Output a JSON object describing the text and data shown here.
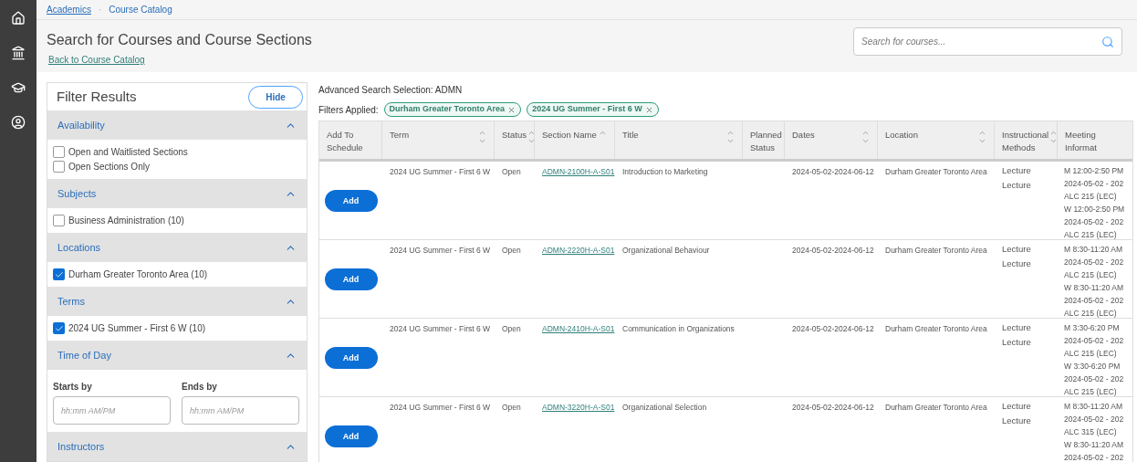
{
  "nav": {
    "items": [
      {
        "selected": false
      },
      {
        "selected": false
      },
      {
        "selected": false
      },
      {
        "selected": false
      }
    ]
  },
  "breadcrumb": [
    "Academics",
    "·",
    "Course Catalog"
  ],
  "header": {
    "title": "Search for Courses and Course Sections",
    "back_link": "Back to Course Catalog",
    "search": {
      "placeholder": "Search for courses..."
    }
  },
  "filter": {
    "title": "Filter Results",
    "hide_button": "Hide",
    "sections": [
      {
        "kind": "checkboxes",
        "title": "Availability",
        "expanded": true,
        "options": [
          {
            "label": "Open and Waitlisted Sections",
            "checked": false
          },
          {
            "label": "Open Sections Only",
            "checked": false
          }
        ]
      },
      {
        "kind": "checkboxes",
        "title": "Subjects",
        "expanded": true,
        "options": [
          {
            "label": "Business Administration (10)",
            "checked": false
          }
        ]
      },
      {
        "kind": "checkboxes",
        "title": "Locations",
        "expanded": true,
        "options": [
          {
            "label": "Durham Greater Toronto Area (10)",
            "checked": true
          }
        ]
      },
      {
        "kind": "checkboxes",
        "title": "Terms",
        "expanded": true,
        "options": [
          {
            "label": "2024 UG Summer - First 6 W (10)",
            "checked": true
          }
        ]
      },
      {
        "kind": "time",
        "title": "Time of Day",
        "expanded": true,
        "fields": [
          {
            "label": "Starts by",
            "placeholder": "hh:mm AM/PM"
          },
          {
            "label": "Ends by",
            "placeholder": "hh:mm AM/PM"
          }
        ]
      },
      {
        "kind": "checkboxes",
        "title": "Instructors",
        "expanded": true
      }
    ]
  },
  "results": {
    "selection": "Advanced Search Selection: ADMN",
    "filters_label": "Filters Applied:",
    "filters": [
      "Durham Greater Toronto Area",
      "2024 UG Summer - First 6 W"
    ],
    "columns": [
      {
        "label": "Add To Schedule",
        "kind": "plain"
      },
      {
        "label": "Term",
        "kind": "sortable"
      },
      {
        "label": "Status",
        "kind": "sortable"
      },
      {
        "label": "Section Name",
        "kind": "ascending"
      },
      {
        "label": "Title",
        "kind": "sortable"
      },
      {
        "label": "Planned Status",
        "kind": "plain"
      },
      {
        "label": "Dates",
        "kind": "sortable"
      },
      {
        "label": "Location",
        "kind": "sortable"
      },
      {
        "label": "Instructional Methods",
        "kind": "sortable"
      },
      {
        "label": "Meeting Informat",
        "kind": "plain"
      }
    ],
    "rows": [
      {
        "button": "Add",
        "term": "2024 UG Summer - First 6 W",
        "status": "Open",
        "section": "ADMN-2100H-A-S01",
        "title": "Introduction to Marketing",
        "dates": "2024-05-02-2024-06-12",
        "location": "Durham Greater Toronto Area",
        "methods": [
          "Lecture",
          "Lecture"
        ],
        "meeting": [
          "M 12:00-2:50 PM",
          "2024-05-02 - 202",
          "ALC 215 (LEC)",
          "W 12:00-2:50 PM",
          "2024-05-02 - 202",
          "ALC 215 (LEC)"
        ]
      },
      {
        "button": "Add",
        "term": "2024 UG Summer - First 6 W",
        "status": "Open",
        "section": "ADMN-2220H-A-S01",
        "title": "Organizational Behaviour",
        "dates": "2024-05-02-2024-06-12",
        "location": "Durham Greater Toronto Area",
        "methods": [
          "Lecture",
          "Lecture"
        ],
        "meeting": [
          "M 8:30-11:20 AM",
          "2024-05-02 - 202",
          "ALC 215 (LEC)",
          "W 8:30-11:20 AM",
          "2024-05-02 - 202",
          "ALC 215 (LEC)"
        ]
      },
      {
        "button": "Add",
        "term": "2024 UG Summer - First 6 W",
        "status": "Open",
        "section": "ADMN-2410H-A-S01",
        "title": "Communication in Organizations",
        "dates": "2024-05-02-2024-06-12",
        "location": "Durham Greater Toronto Area",
        "methods": [
          "Lecture",
          "Lecture"
        ],
        "meeting": [
          "M 3:30-6:20 PM",
          "2024-05-02 - 202",
          "ALC 215 (LEC)",
          "W 3:30-6:20 PM",
          "2024-05-02 - 202",
          "ALC 215 (LEC)"
        ]
      },
      {
        "button": "Add",
        "term": "2024 UG Summer - First 6 W",
        "status": "Open",
        "section": "ADMN-3220H-A-S01",
        "title": "Organizational Selection",
        "dates": "2024-05-02-2024-06-12",
        "location": "Durham Greater Toronto Area",
        "methods": [
          "Lecture",
          "Lecture"
        ],
        "meeting": [
          "M 8:30-11:20 AM",
          "2024-05-02 - 202",
          "ALC 315 (LEC)",
          "W 8:30-11:20 AM",
          "2024-05-02 - 202"
        ]
      }
    ]
  }
}
